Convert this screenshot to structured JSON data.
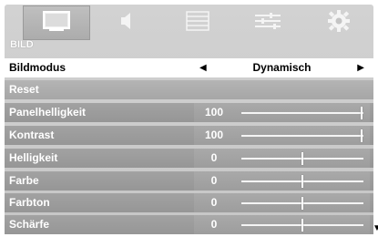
{
  "tabs": [
    {
      "icon": "picture-icon",
      "active": true
    },
    {
      "icon": "speaker-icon",
      "active": false
    },
    {
      "icon": "list-icon",
      "active": false
    },
    {
      "icon": "sliders-icon",
      "active": false
    },
    {
      "icon": "gear-icon",
      "active": false
    }
  ],
  "section": {
    "label": "BILD"
  },
  "settings": {
    "bildmodus": {
      "label": "Bildmodus",
      "value": "Dynamisch"
    },
    "reset": {
      "label": "Reset"
    },
    "panelhelligkeit": {
      "label": "Panelhelligkeit",
      "value": "100",
      "level": 1.0
    },
    "kontrast": {
      "label": "Kontrast",
      "value": "100",
      "level": 1.0
    },
    "helligkeit": {
      "label": "Helligkeit",
      "value": "0",
      "level": 0.5
    },
    "farbe": {
      "label": "Farbe",
      "value": "0",
      "level": 0.5
    },
    "farbton": {
      "label": "Farbton",
      "value": "0",
      "level": 0.5
    },
    "schaerfe": {
      "label": "Schärfe",
      "value": "0",
      "level": 0.5
    }
  },
  "colors": {
    "accent": "#ffffff",
    "panel": "#c9c9c9",
    "row": "#9e9e9e"
  }
}
